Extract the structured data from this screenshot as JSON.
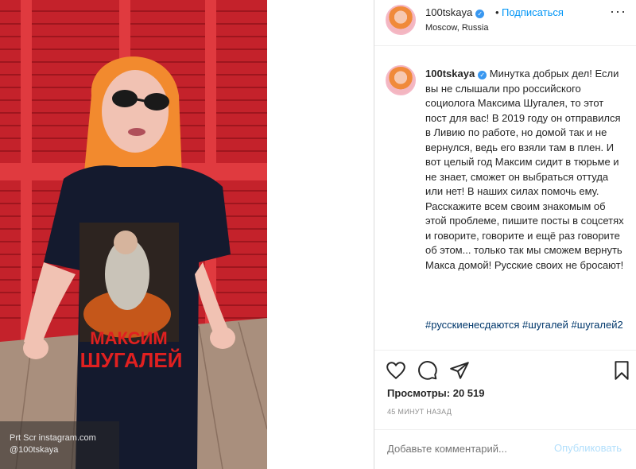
{
  "photo": {
    "shirt_text_line1": "МАКСИМ",
    "shirt_text_line2": "ШУГАЛЕЙ",
    "watermark_line1": "Prt Scr instagram.com",
    "watermark_line2": "@100tskaya"
  },
  "post": {
    "username": "100tskaya",
    "dot": "•",
    "follow_label": "Подписаться",
    "location": "Moscow, Russia",
    "caption_username": "100tskaya",
    "caption_text": "Минутка добрых дел! Если вы не слышали про российского социолога Максима Шугалея, то этот пост для вас! В 2019 году он отправился в Ливию по работе, но домой так и не вернулся, ведь его взяли там в плен. И вот целый год Максим сидит в тюрьме и не знает, сможет он выбраться оттуда или нет! В наших силах помочь ему. Расскажите всем своим знакомым об этой проблеме, пишите посты в соцсетях и говорите, говорите и ещё раз говорите об этом... только так мы сможем вернуть Макса домой! Русские своих не бросают!",
    "hashtags": "#русскиенесдаются #шугалей #шугалей2",
    "views_label": "Просмотры:",
    "views_count": "20 519",
    "time_ago": "45 МИНУТ НАЗАД",
    "comment_placeholder": "Добавьте комментарий...",
    "publish_label": "Опубликовать"
  },
  "icons": [
    "more-icon",
    "verified-icon",
    "heart-icon",
    "comment-icon",
    "share-icon",
    "bookmark-icon"
  ],
  "colors": {
    "accent": "#0095f6",
    "hashtag": "#00376b",
    "verified": "#3897f0",
    "muted": "#8e8e8e"
  }
}
